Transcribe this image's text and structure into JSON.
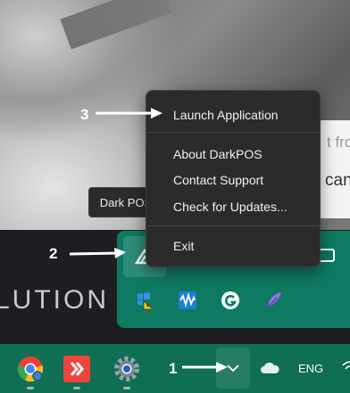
{
  "background": {
    "page_card": {
      "text_1": "t fro",
      "text_2": "can"
    },
    "banner_text": "LUTION"
  },
  "tooltip": {
    "text": "Dark POS"
  },
  "context_menu": {
    "items": [
      {
        "label": "Launch Application"
      },
      {
        "label": "About DarkPOS"
      },
      {
        "label": "Contact Support"
      },
      {
        "label": "Check for Updates..."
      },
      {
        "label": "Exit"
      }
    ]
  },
  "tray_flyout": {
    "icons": [
      "darkpos-icon",
      "defender-warning-icon",
      "audio-wave-icon",
      "grammarly-icon",
      "feather-icon"
    ]
  },
  "taskbar": {
    "apps": [
      "chrome-icon",
      "anydesk-icon",
      "settings-icon"
    ],
    "language": "ENG"
  },
  "annotations": {
    "step1": "1",
    "step2": "2",
    "step3": "3"
  },
  "colors": {
    "taskbar": "#0f6e53",
    "flyout": "#0f7a62",
    "menu_bg": "#2b2b2b",
    "annotation": "#ffffff"
  }
}
